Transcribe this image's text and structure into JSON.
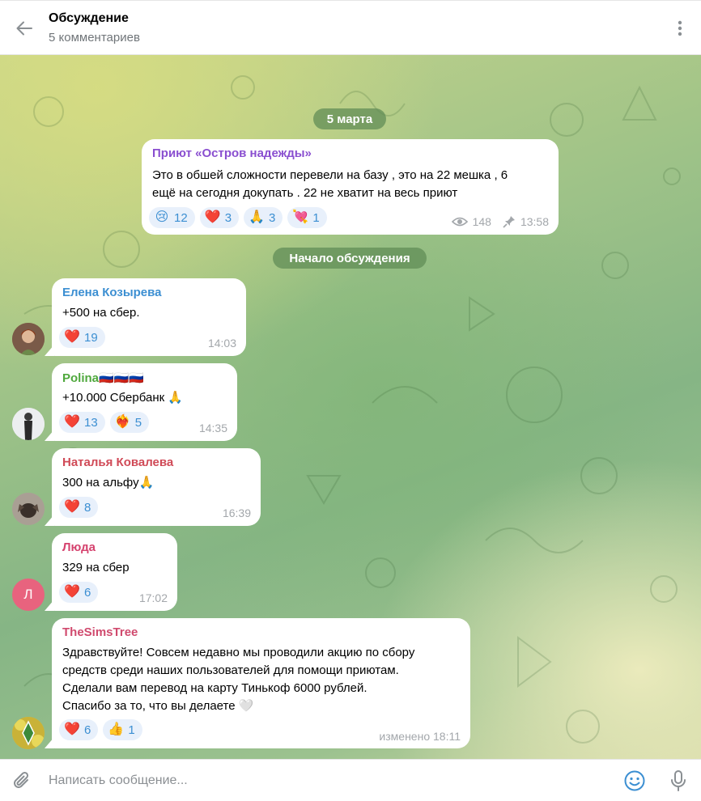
{
  "header": {
    "title": "Обсуждение",
    "subtitle": "5 комментариев"
  },
  "date_pill": "5 марта",
  "discussion_pill": "Начало обсуждения",
  "post": {
    "author": "Приют «Остров надежды»",
    "author_color": "#8a4fd0",
    "lines": [
      "Это в обшей сложности перевели на базу , это на 22 мешка , 6",
      "ещё на сегодня докупать . 22 не хватит на весь приют"
    ],
    "reactions": [
      {
        "emoji": "😢",
        "count": "12"
      },
      {
        "emoji": "❤️",
        "count": "3"
      },
      {
        "emoji": "🙏",
        "count": "3"
      },
      {
        "emoji": "💘",
        "count": "1"
      }
    ],
    "views": "148",
    "time": "13:58"
  },
  "comments": [
    {
      "author": "Елена Козырева",
      "author_color": "#3c8fd2",
      "text": "+500 на сбер.",
      "reactions": [
        {
          "emoji": "❤️",
          "count": "19"
        }
      ],
      "time": "14:03"
    },
    {
      "author": "Polina🇷🇺🇷🇺🇷🇺",
      "author_color": "#4fa83d",
      "text": "+10.000 Сбербанк 🙏",
      "reactions": [
        {
          "emoji": "❤️",
          "count": "13"
        },
        {
          "emoji": "❤️‍🔥",
          "count": "5"
        }
      ],
      "time": "14:35"
    },
    {
      "author": "Наталья Ковалева",
      "author_color": "#d04a57",
      "text": "300 на альфу🙏",
      "reactions": [
        {
          "emoji": "❤️",
          "count": "8"
        }
      ],
      "time": "16:39"
    },
    {
      "author": "Люда",
      "author_color": "#d5426e",
      "text": "329 на сбер",
      "reactions": [
        {
          "emoji": "❤️",
          "count": "6"
        }
      ],
      "time": "17:02",
      "avatar_letter": "Л",
      "avatar_color": "#e8637e"
    },
    {
      "author": "TheSimsTree",
      "author_color": "#d04a6e",
      "lines": [
        "Здравствуйте! Совсем недавно мы проводили акцию по сбору",
        "средств среди наших пользователей для помощи приютам.",
        "Сделали вам перевод на карту Тинькоф 6000 рублей.",
        "Спасибо за то, что вы делаете 🤍"
      ],
      "reactions": [
        {
          "emoji": "❤️",
          "count": "6"
        },
        {
          "emoji": "👍",
          "count": "1"
        }
      ],
      "time": "изменено 18:11"
    }
  ],
  "composer": {
    "placeholder": "Написать сообщение..."
  },
  "icons": {
    "back": "arrow-left-icon",
    "menu": "more-vertical-icon",
    "views": "eye-icon",
    "pinned": "pin-icon",
    "attach": "paperclip-icon",
    "emoji": "smile-icon",
    "mic": "microphone-icon"
  }
}
